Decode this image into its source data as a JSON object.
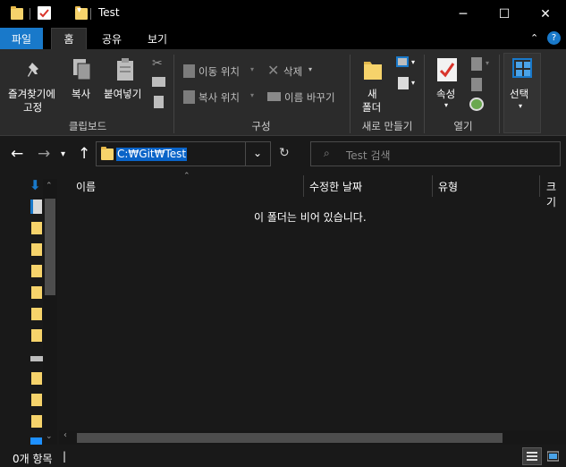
{
  "window": {
    "title": "Test",
    "buttons": {
      "minimize": "─",
      "maximize": "☐",
      "close": "✕"
    }
  },
  "ribbon_tabs": [
    "파일",
    "홈",
    "공유",
    "보기"
  ],
  "ribbon": {
    "clipboard": {
      "pin_line1": "즐겨찾기에",
      "pin_line2": "고정",
      "copy": "복사",
      "paste": "붙여넣기",
      "caption": "클립보드"
    },
    "organize": {
      "move_to": "이동 위치",
      "copy_to": "복사 위치",
      "delete": "삭제",
      "rename": "이름 바꾸기",
      "caption": "구성"
    },
    "new": {
      "new_folder_line1": "새",
      "new_folder_line2": "폴더",
      "caption": "새로 만들기"
    },
    "open": {
      "properties": "속성",
      "caption": "열기"
    },
    "select": {
      "label": "선택"
    }
  },
  "address": {
    "path": "C:₩Git₩Test",
    "search_placeholder": "Test 검색"
  },
  "columns": [
    "이름",
    "수정한 날짜",
    "유형",
    "크기"
  ],
  "content": {
    "empty_message": "이 폴더는 비어 있습니다."
  },
  "status": {
    "item_count": "0개 항목",
    "cursor": "|"
  },
  "colors": {
    "accent": "#1979ca",
    "selection": "#0a64c8",
    "folder": "#f6d36b",
    "background": "#191919",
    "ribbon": "#2b2b2b"
  }
}
